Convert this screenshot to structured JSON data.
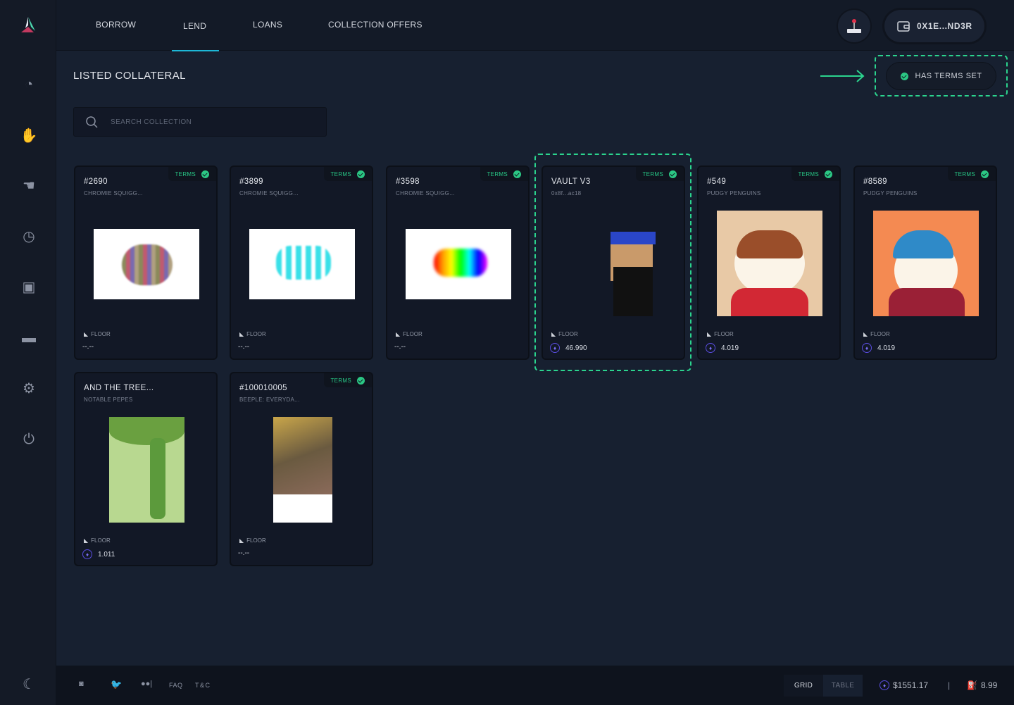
{
  "nav": {
    "tabs": [
      {
        "label": "BORROW"
      },
      {
        "label": "LEND"
      },
      {
        "label": "LOANS"
      },
      {
        "label": "COLLECTION OFFERS"
      }
    ],
    "active": "LEND",
    "wallet": "0X1E...ND3R"
  },
  "sidebar": {
    "icons": [
      "dashboard-icon",
      "borrow-hand-icon",
      "lend-hand-icon",
      "loans-timer-icon",
      "collateral-box-icon",
      "wallet-icon",
      "settings-gear-icon",
      "power-icon",
      "moon-icon"
    ]
  },
  "page": {
    "title": "LISTED COLLATERAL",
    "filter": "HAS TERMS SET",
    "search_placeholder": "SEARCH COLLECTION"
  },
  "cards": [
    {
      "name": "#2690",
      "collection": "CHROMIE SQUIGG...",
      "terms": "TERMS",
      "floor_label": "FLOOR",
      "floor": "--.--"
    },
    {
      "name": "#3899",
      "collection": "CHROMIE SQUIGG...",
      "terms": "TERMS",
      "floor_label": "FLOOR",
      "floor": "--.--"
    },
    {
      "name": "#3598",
      "collection": "CHROMIE SQUIGG...",
      "terms": "TERMS",
      "floor_label": "FLOOR",
      "floor": "--.--"
    },
    {
      "name": "VAULT V3",
      "collection": "0x8f...ac18",
      "terms": "TERMS",
      "floor_label": "FLOOR",
      "floor": "46.990"
    },
    {
      "name": "#549",
      "collection": "PUDGY PENGUINS",
      "terms": "TERMS",
      "floor_label": "FLOOR",
      "floor": "4.019"
    },
    {
      "name": "#8589",
      "collection": "PUDGY PENGUINS",
      "terms": "TERMS",
      "floor_label": "FLOOR",
      "floor": "4.019"
    },
    {
      "name": "AND THE TREE...",
      "collection": "NOTABLE PEPES",
      "terms": "",
      "floor_label": "FLOOR",
      "floor": "1.011"
    },
    {
      "name": "#100010005",
      "collection": "BEEPLE: EVERYDA...",
      "terms": "TERMS",
      "floor_label": "FLOOR",
      "floor": "--.--"
    }
  ],
  "footer": {
    "faq": "FAQ",
    "tc": "T&C",
    "grid": "GRID",
    "table": "TABLE",
    "eth_price": "$1551.17",
    "gas": "8.99"
  },
  "colors": {
    "accent": "#1db7d6",
    "terms": "#28c987",
    "highlight": "#2bd48e",
    "eth": "#5a4de0"
  }
}
